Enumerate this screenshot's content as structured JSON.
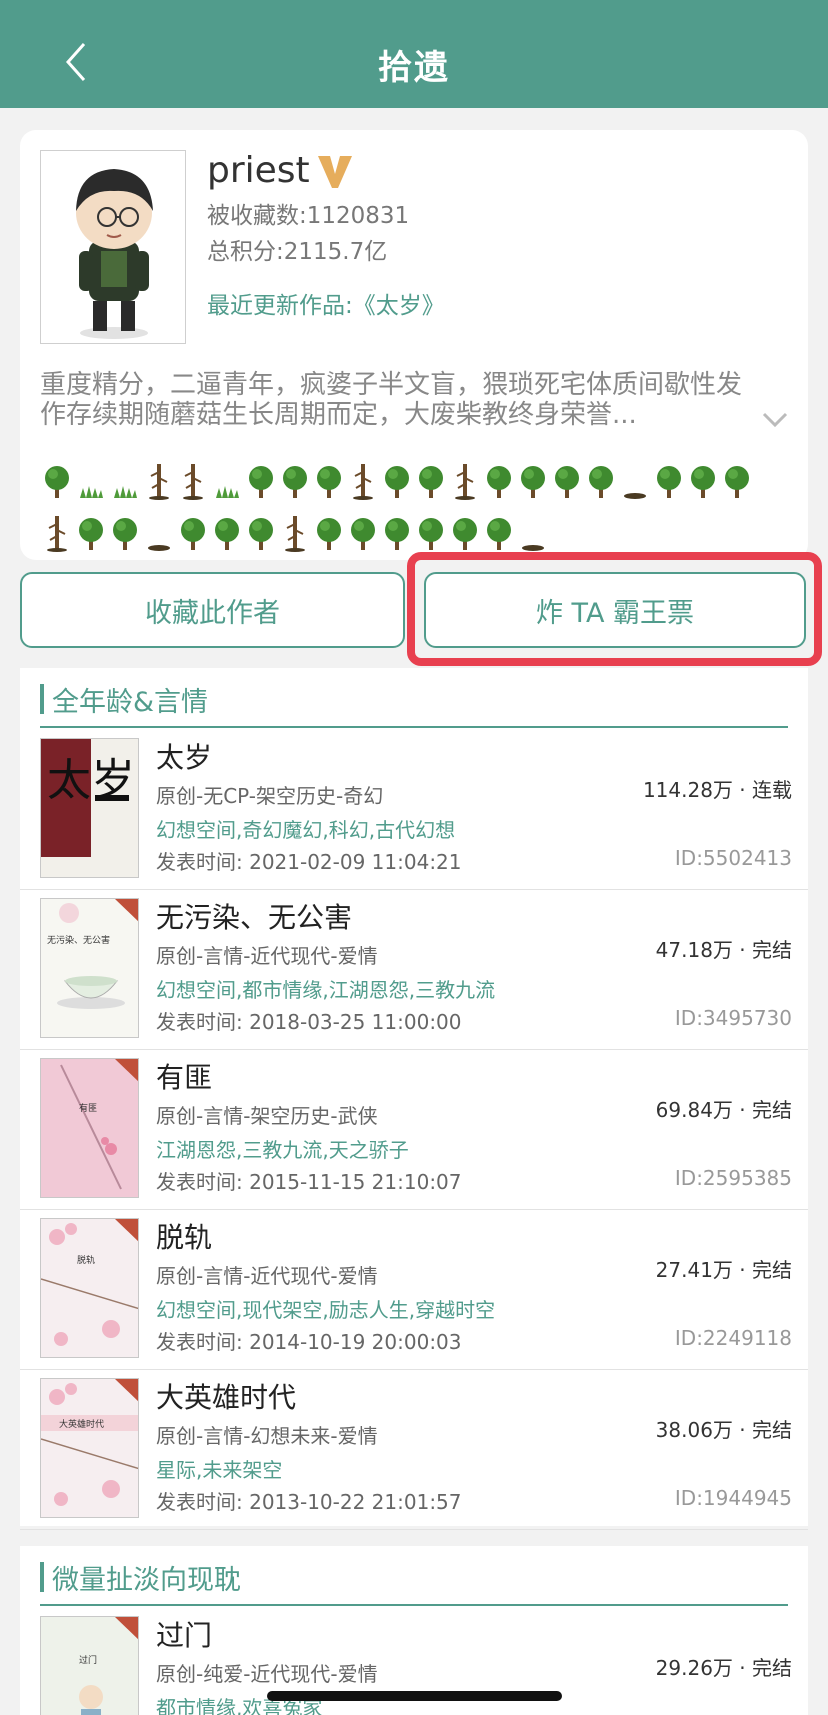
{
  "topbar": {
    "title": "拾遗"
  },
  "author": {
    "name": "priest",
    "favorites": "被收藏数:1120831",
    "score": "总积分:2115.7亿",
    "latest": "最近更新作品:《太岁》",
    "bio": "重度精分，二逼青年，疯婆子半文盲，猥琐死宅体质间歇性发作存续期随蘑菇生长周期而定，大废柴教终身荣誉..."
  },
  "trees": {
    "row1": [
      "tree",
      "grass",
      "grass",
      "bare",
      "bare",
      "grass",
      "tree",
      "tree",
      "tree",
      "bare",
      "tree",
      "tree",
      "bare",
      "tree",
      "tree",
      "tree",
      "tree",
      "dirt",
      "tree",
      "tree",
      "tree"
    ],
    "row2": [
      "bare",
      "tree",
      "tree",
      "dirt",
      "tree",
      "tree",
      "tree",
      "bare",
      "tree",
      "tree",
      "tree",
      "tree",
      "tree",
      "tree",
      "dirt"
    ]
  },
  "buttons": {
    "favorite": "收藏此作者",
    "vote": "炸 TA 霸王票"
  },
  "sections": [
    {
      "title": "全年龄&言情",
      "books": [
        {
          "title": "太岁",
          "category": "原创-无CP-架空历史-奇幻",
          "tags": "幻想空间,奇幻魔幻,科幻,古代幻想",
          "date": "发表时间: 2021-02-09 11:04:21",
          "count": "114.28万 · 连载",
          "id": "ID:5502413",
          "cover": "taisui"
        },
        {
          "title": "无污染、无公害",
          "category": "原创-言情-近代现代-爱情",
          "tags": "幻想空间,都市情缘,江湖恩怨,三教九流",
          "date": "发表时间: 2018-03-25 11:00:00",
          "count": "47.18万 · 完结",
          "id": "ID:3495730",
          "cover": "cup"
        },
        {
          "title": "有匪",
          "category": "原创-言情-架空历史-武侠",
          "tags": "江湖恩怨,三教九流,天之骄子",
          "date": "发表时间: 2015-11-15 21:10:07",
          "count": "69.84万 · 完结",
          "id": "ID:2595385",
          "cover": "pink"
        },
        {
          "title": "脱轨",
          "category": "原创-言情-近代现代-爱情",
          "tags": "幻想空间,现代架空,励志人生,穿越时空",
          "date": "发表时间: 2014-10-19 20:00:03",
          "count": "27.41万 · 完结",
          "id": "ID:2249118",
          "cover": "blossom"
        },
        {
          "title": "大英雄时代",
          "category": "原创-言情-幻想未来-爱情",
          "tags": "星际,未来架空",
          "date": "发表时间: 2013-10-22 21:01:57",
          "count": "38.06万 · 完结",
          "id": "ID:1944945",
          "cover": "blossom2"
        }
      ]
    },
    {
      "title": "微量扯淡向现耽",
      "books": [
        {
          "title": "过门",
          "category": "原创-纯爱-近代现代-爱情",
          "tags": "都市情缘,欢喜冤家",
          "date": "",
          "count": "29.26万 · 完结",
          "id": "",
          "cover": "guomen"
        }
      ]
    }
  ],
  "cover_texts": {
    "taisui_big": "太岁",
    "cup": "无污染、无公害",
    "pink": "有匪",
    "blossom": "脱轨",
    "blossom2": "大英雄时代",
    "guomen": "过门"
  },
  "colors": {
    "accent": "#519c8c",
    "highlight": "#e8404f"
  }
}
